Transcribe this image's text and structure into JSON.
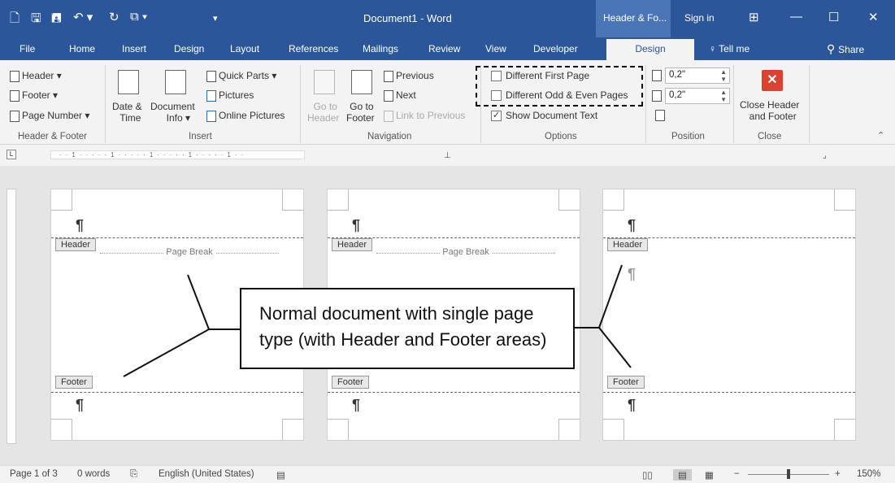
{
  "window": {
    "title": "Document1  -  Word",
    "context_tab": "Header & Fo...",
    "sign_in": "Sign in"
  },
  "qat": {
    "new": "🗋",
    "save": "🖫",
    "save_as": "🖪",
    "undo": "↶ ▾",
    "redo": "↻",
    "touch": "⧉ ▾",
    "customize": "▾"
  },
  "window_buttons": {
    "ribbon_display": "⊞",
    "minimize": "—",
    "maximize": "☐",
    "close": "✕"
  },
  "tabs": [
    "File",
    "Home",
    "Insert",
    "Design",
    "Layout",
    "References",
    "Mailings",
    "Review",
    "View",
    "Developer"
  ],
  "active_tab": "Design",
  "tell_me": "Tell me",
  "share": "Share",
  "ribbon": {
    "header_footer": {
      "header": "Header ▾",
      "footer": "Footer ▾",
      "page_number": "Page Number ▾",
      "group": "Header & Footer"
    },
    "insert": {
      "date_time_1": "Date &",
      "date_time_2": "Time",
      "doc_info_1": "Document",
      "doc_info_2": "Info ▾",
      "quick_parts": "Quick Parts ▾",
      "pictures": "Pictures",
      "online_pictures": "Online Pictures",
      "group": "Insert"
    },
    "navigation": {
      "goto_header_1": "Go to",
      "goto_header_2": "Header",
      "goto_footer_1": "Go to",
      "goto_footer_2": "Footer",
      "previous": "Previous",
      "next": "Next",
      "link_prev": "Link to Previous",
      "group": "Navigation"
    },
    "options": {
      "diff_first": "Different First Page",
      "diff_odd_even": "Different Odd & Even Pages",
      "show_doc_text": "Show Document Text",
      "group": "Options",
      "diff_first_checked": false,
      "diff_odd_even_checked": false,
      "show_doc_text_checked": true
    },
    "position": {
      "header_from_top": "0,2\"",
      "footer_from_bottom": "0,2\"",
      "group": "Position"
    },
    "close": {
      "label_1": "Close Header",
      "label_2": "and Footer",
      "group": "Close"
    }
  },
  "pages": [
    {
      "header": "Header",
      "footer": "Footer",
      "page_break": "Page Break"
    },
    {
      "header": "Header",
      "footer": "Footer",
      "page_break": "Page Break"
    },
    {
      "header": "Header",
      "footer": "Footer"
    }
  ],
  "callout": {
    "line1": "Normal document with  single page",
    "line2": "type (with Header and Footer areas)"
  },
  "status": {
    "page": "Page 1 of 3",
    "words": "0 words",
    "language": "English (United States)",
    "zoom": "150%"
  },
  "colors": {
    "title_blue": "#2b579a",
    "close_red": "#d9432f"
  }
}
